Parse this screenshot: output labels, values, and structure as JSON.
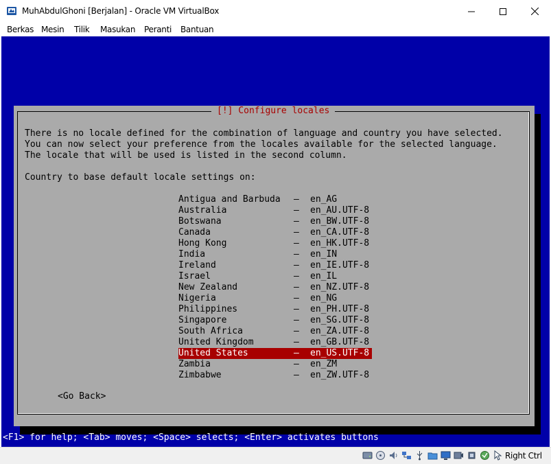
{
  "window": {
    "title": "MuhAbdulGhoni [Berjalan] - Oracle VM VirtualBox"
  },
  "menu": {
    "items": [
      "Berkas",
      "Mesin",
      "Tilik",
      "Masukan",
      "Peranti",
      "Bantuan"
    ]
  },
  "dialog": {
    "title": "[!] Configure locales",
    "description": [
      "There is no locale defined for the combination of language and country you have selected.",
      "You can now select your preference from the locales available for the selected language.",
      "The locale that will be used is listed in the second column."
    ],
    "prompt": "Country to base default locale settings on:",
    "locales": [
      {
        "country": "Antigua and Barbuda",
        "code": "en_AG"
      },
      {
        "country": "Australia",
        "code": "en_AU.UTF-8"
      },
      {
        "country": "Botswana",
        "code": "en_BW.UTF-8"
      },
      {
        "country": "Canada",
        "code": "en_CA.UTF-8"
      },
      {
        "country": "Hong Kong",
        "code": "en_HK.UTF-8"
      },
      {
        "country": "India",
        "code": "en_IN"
      },
      {
        "country": "Ireland",
        "code": "en_IE.UTF-8"
      },
      {
        "country": "Israel",
        "code": "en_IL"
      },
      {
        "country": "New Zealand",
        "code": "en_NZ.UTF-8"
      },
      {
        "country": "Nigeria",
        "code": "en_NG"
      },
      {
        "country": "Philippines",
        "code": "en_PH.UTF-8"
      },
      {
        "country": "Singapore",
        "code": "en_SG.UTF-8"
      },
      {
        "country": "South Africa",
        "code": "en_ZA.UTF-8"
      },
      {
        "country": "United Kingdom",
        "code": "en_GB.UTF-8"
      },
      {
        "country": "United States",
        "code": "en_US.UTF-8"
      },
      {
        "country": "Zambia",
        "code": "en_ZM"
      },
      {
        "country": "Zimbabwe",
        "code": "en_ZW.UTF-8"
      }
    ],
    "selected_country": "United States",
    "separator": "–",
    "go_back_label": "<Go Back>"
  },
  "help_line": "<F1> for help; <Tab> moves; <Space> selects; <Enter> activates buttons",
  "statusbar": {
    "icons": [
      "hard-disk-icon",
      "optical-drive-icon",
      "audio-icon",
      "network-icon",
      "usb-icon",
      "shared-folders-icon",
      "display-icon",
      "video-capture-icon",
      "cpu-icon",
      "virtualization-icon",
      "mouse-integration-icon"
    ],
    "host_key_label": "Right Ctrl"
  },
  "colors": {
    "guest_background": "#0000a8",
    "dialog_background": "#aaaaaa",
    "dialog_title": "#a80000",
    "selection": "#a80000"
  }
}
